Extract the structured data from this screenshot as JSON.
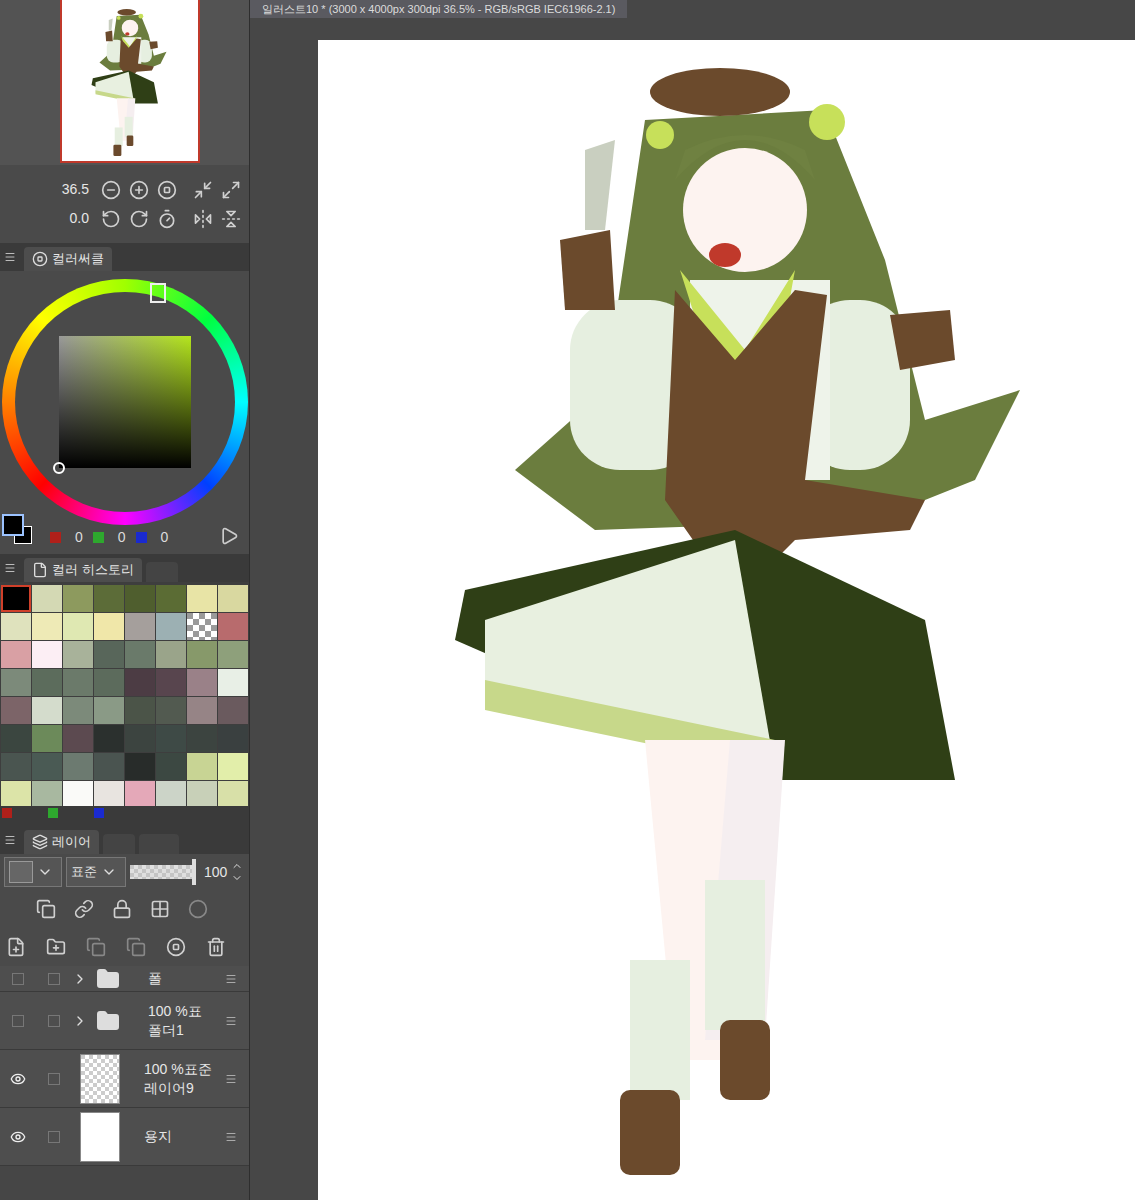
{
  "document_tab": {
    "title": "일러스트10 * (3000 x 4000px 300dpi 36.5% - RGB/sRGB IEC61966-2.1)"
  },
  "navigator": {
    "zoom": "36.5",
    "rotation": "0.0"
  },
  "color_circle": {
    "tab": "컬러써클",
    "hue_color": "#b5e61d",
    "main_color": "#000000",
    "sub_color": "#000000",
    "rgb": [
      {
        "value": "0",
        "color": "#b0201a"
      },
      {
        "value": "0",
        "color": "#2ea82e"
      },
      {
        "value": "0",
        "color": "#1a2ad0"
      }
    ]
  },
  "color_history": {
    "tab": "컬러 히스토리",
    "swatches": [
      {
        "kind": "color",
        "color": "#000000",
        "selected": true
      },
      {
        "kind": "color",
        "color": "#d4d9b4",
        "selected": false
      },
      {
        "kind": "color",
        "color": "#8d9a5e",
        "selected": false
      },
      {
        "kind": "color",
        "color": "#5c6c38",
        "selected": false
      },
      {
        "kind": "color",
        "color": "#4f5e2e",
        "selected": false
      },
      {
        "kind": "color",
        "color": "#5b6c34",
        "selected": false
      },
      {
        "kind": "color",
        "color": "#e8e4a6",
        "selected": false
      },
      {
        "kind": "color",
        "color": "#d9d8a0",
        "selected": false
      },
      {
        "kind": "color",
        "color": "#dfe2bd",
        "selected": false
      },
      {
        "kind": "color",
        "color": "#eeeab6",
        "selected": false
      },
      {
        "kind": "color",
        "color": "#dfe8b2",
        "selected": false
      },
      {
        "kind": "color",
        "color": "#f0e7a9",
        "selected": false
      },
      {
        "kind": "color",
        "color": "#a59f9c",
        "selected": false
      },
      {
        "kind": "color",
        "color": "#9cb0b3",
        "selected": false
      },
      {
        "kind": "transparent",
        "color": "#ffffff",
        "selected": false
      },
      {
        "kind": "color",
        "color": "#b86b6d",
        "selected": false
      },
      {
        "kind": "color",
        "color": "#d9a0a4",
        "selected": false
      },
      {
        "kind": "color",
        "color": "#fceef4",
        "selected": false
      },
      {
        "kind": "color",
        "color": "#a8b29a",
        "selected": false
      },
      {
        "kind": "color",
        "color": "#58665a",
        "selected": false
      },
      {
        "kind": "color",
        "color": "#6a7a6a",
        "selected": false
      },
      {
        "kind": "color",
        "color": "#9aa48a",
        "selected": false
      },
      {
        "kind": "color",
        "color": "#87996a",
        "selected": false
      },
      {
        "kind": "color",
        "color": "#8ea07b",
        "selected": false
      },
      {
        "kind": "color",
        "color": "#7c8a7a",
        "selected": false
      },
      {
        "kind": "color",
        "color": "#5c6c5c",
        "selected": false
      },
      {
        "kind": "color",
        "color": "#6b7a6a",
        "selected": false
      },
      {
        "kind": "color",
        "color": "#5c6b5c",
        "selected": false
      },
      {
        "kind": "color",
        "color": "#4c3c44",
        "selected": false
      },
      {
        "kind": "color",
        "color": "#58454e",
        "selected": false
      },
      {
        "kind": "color",
        "color": "#9a8188",
        "selected": false
      },
      {
        "kind": "color",
        "color": "#e8efe6",
        "selected": false
      },
      {
        "kind": "color",
        "color": "#7c6468",
        "selected": false
      },
      {
        "kind": "color",
        "color": "#d4dccc",
        "selected": false
      },
      {
        "kind": "color",
        "color": "#7c8a7a",
        "selected": false
      },
      {
        "kind": "color",
        "color": "#8a9a86",
        "selected": false
      },
      {
        "kind": "color",
        "color": "#4b5448",
        "selected": false
      },
      {
        "kind": "color",
        "color": "#525a50",
        "selected": false
      },
      {
        "kind": "color",
        "color": "#968486",
        "selected": false
      },
      {
        "kind": "color",
        "color": "#6a5a5e",
        "selected": false
      },
      {
        "kind": "color",
        "color": "#3b4640",
        "selected": false
      },
      {
        "kind": "color",
        "color": "#6c8a5a",
        "selected": false
      },
      {
        "kind": "color",
        "color": "#5c4a50",
        "selected": false
      },
      {
        "kind": "color",
        "color": "#2b302e",
        "selected": false
      },
      {
        "kind": "color",
        "color": "#3c4440",
        "selected": false
      },
      {
        "kind": "color",
        "color": "#3e4a46",
        "selected": false
      },
      {
        "kind": "color",
        "color": "#3c4440",
        "selected": false
      },
      {
        "kind": "color",
        "color": "#3a4040",
        "selected": false
      },
      {
        "kind": "color",
        "color": "#4a5550",
        "selected": false
      },
      {
        "kind": "color",
        "color": "#4a5a54",
        "selected": false
      },
      {
        "kind": "color",
        "color": "#6c7a70",
        "selected": false
      },
      {
        "kind": "color",
        "color": "#4a5450",
        "selected": false
      },
      {
        "kind": "color",
        "color": "#282c2a",
        "selected": false
      },
      {
        "kind": "color",
        "color": "#3c4842",
        "selected": false
      },
      {
        "kind": "color",
        "color": "#c8d494",
        "selected": false
      },
      {
        "kind": "color",
        "color": "#e2eeaa",
        "selected": false
      },
      {
        "kind": "color",
        "color": "#dce4a8",
        "selected": false
      },
      {
        "kind": "color",
        "color": "#a8b8a0",
        "selected": false
      },
      {
        "kind": "color",
        "color": "#fafaf8",
        "selected": false
      },
      {
        "kind": "color",
        "color": "#e8e4e0",
        "selected": false
      },
      {
        "kind": "color",
        "color": "#e4a8b8",
        "selected": false
      },
      {
        "kind": "color",
        "color": "#ccd4c8",
        "selected": false
      },
      {
        "kind": "color",
        "color": "#c8d0b8",
        "selected": false
      },
      {
        "kind": "color",
        "color": "#d8e0a8",
        "selected": false
      }
    ],
    "markers": [
      {
        "color": "#b0201a"
      },
      {
        "color": "#2ea82e"
      },
      {
        "color": "#1a2ad0"
      }
    ]
  },
  "layers": {
    "tab": "레이어",
    "blend_mode": "표준",
    "opacity": "100",
    "opacity_level": 1,
    "items": [
      {
        "kind": "folder",
        "mode": "",
        "name": "폴",
        "visible": false,
        "expanded": false
      },
      {
        "kind": "folder",
        "mode": "100 %표",
        "name": "폴더1",
        "visible": false,
        "expanded": false
      },
      {
        "kind": "layer",
        "mode": "100 %표준",
        "name": "레이어9",
        "visible": true,
        "expanded": false
      },
      {
        "kind": "paper",
        "mode": "",
        "name": "용지",
        "visible": true,
        "expanded": false
      }
    ]
  }
}
